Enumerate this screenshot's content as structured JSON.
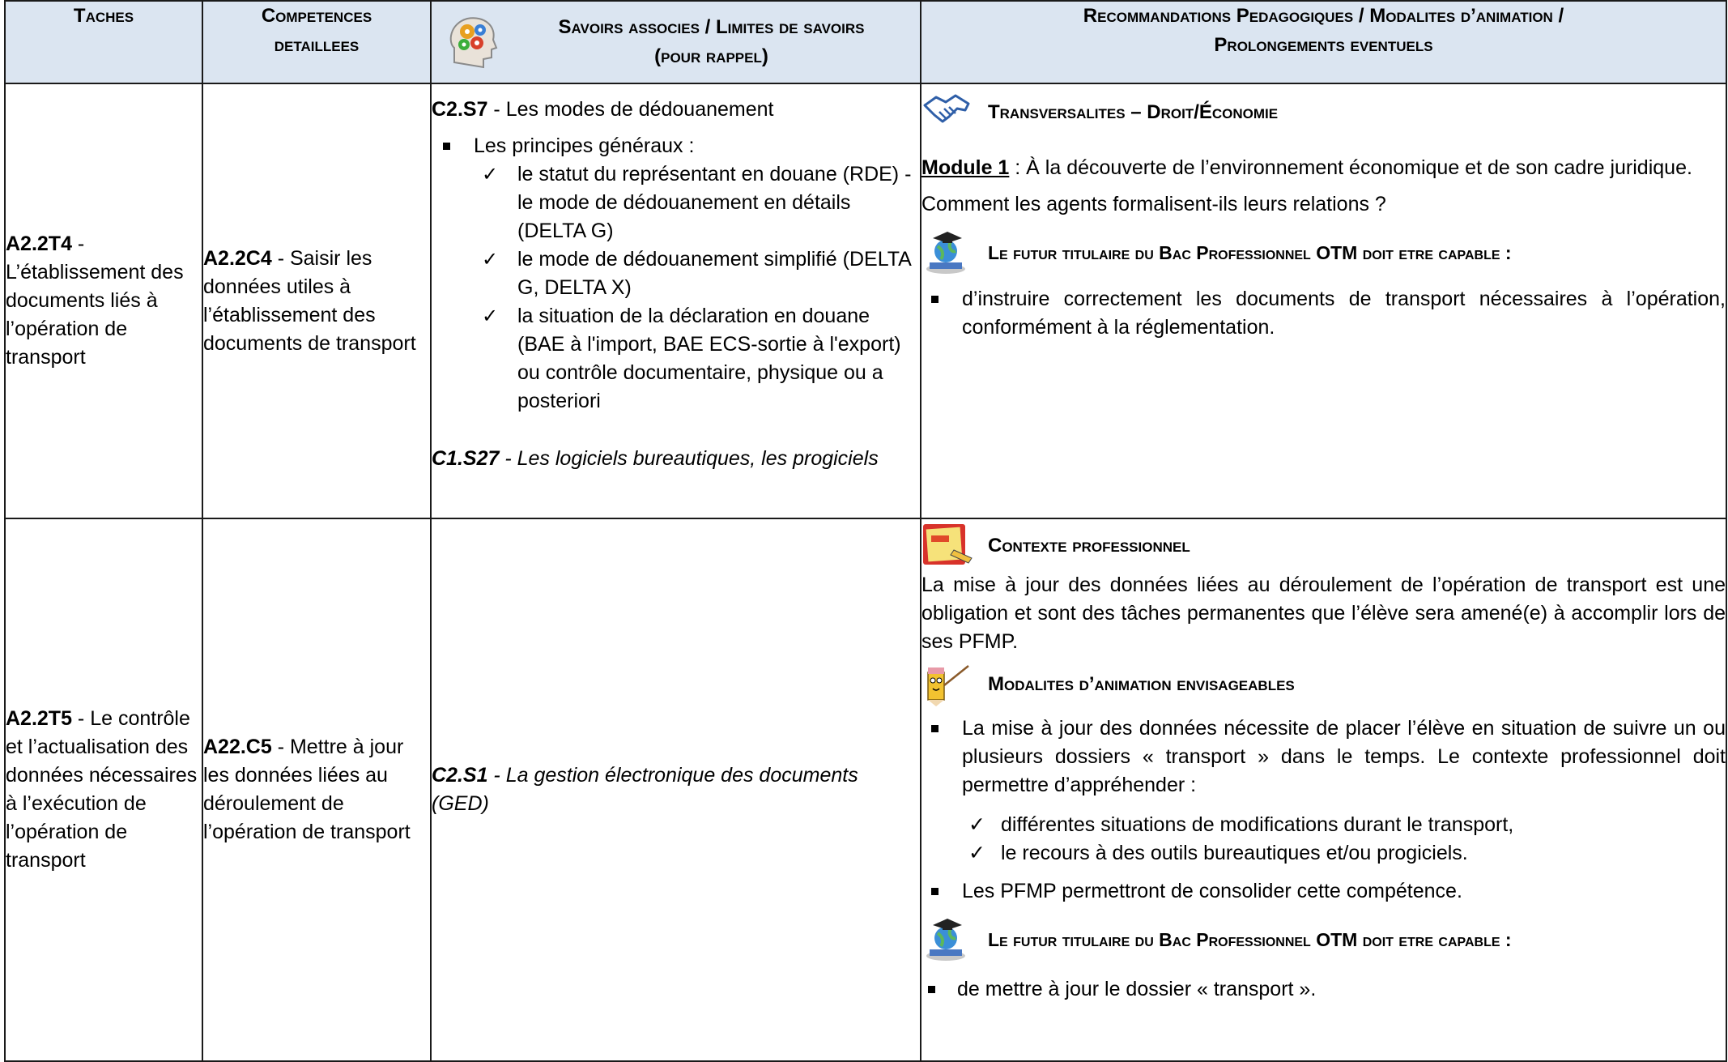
{
  "header": {
    "col1": "Taches",
    "col2_line1": "Competences",
    "col2_line2": "detaillees",
    "col3_line1": "Savoirs associes / Limites de savoirs",
    "col3_line2": "(pour rappel)",
    "col3_icon": "brain-gears-icon",
    "col4_line1": "Recommandations Pedagogiques / Modalites d’animation /",
    "col4_line2": "Prolongements eventuels"
  },
  "rows": [
    {
      "tache_code": "A2.2T4",
      "tache_text": " - L’établissement des documents liés à l’opération de transport",
      "comp_code": "A2.2C4",
      "comp_text": " - Saisir les données utiles à l’établissement des documents de transport",
      "savoirs": {
        "title_code": "C2.S7",
        "title_text": " - Les modes de dédouanement",
        "bullet": "Les principes généraux :",
        "checks": [
          "le statut du représentant en douane (RDE) - le mode de dédouanement en détails (DELTA G)",
          "le mode de dédouanement simplifié (DELTA G, DELTA X)",
          "la situation de la déclaration en douane (BAE à l'import, BAE ECS-sortie à l'export) ou contrôle documentaire, physique ou a posteriori"
        ],
        "extra_code": "C1.S27",
        "extra_text": " - Les logiciels bureautiques, les progiciels"
      },
      "reco": {
        "section1_icon": "handshake-icon",
        "section1_title": "Transversalites – Droit/Économie",
        "module_label": "Module 1",
        "module_text": " : À la découverte de l’environnement économique et de son cadre juridique.",
        "question": "Comment les agents formalisent-ils leurs relations ?",
        "section2_icon": "graduate-globe-icon",
        "section2_title": "Le futur titulaire du Bac Professionnel OTM doit etre capable :",
        "bullet": "d’instruire correctement les documents de transport nécessaires à l’opération, conformément à la réglementation."
      }
    },
    {
      "tache_code": "A2.2T5",
      "tache_text": " - Le contrôle et l’actualisation des données nécessaires à l’exécution de l’opération de transport",
      "comp_code": "A22.C5",
      "comp_text": " - Mettre à jour les données liées au déroulement de l’opération de transport",
      "savoirs": {
        "code": "C2.S1",
        "text": " - La gestion électronique des documents (GED)"
      },
      "reco": {
        "section1_icon": "note-pad-icon",
        "section1_title": "Contexte professionnel",
        "context_text": "La mise à jour des données liées au déroulement de l’opération de transport est une obligation et sont des tâches permanentes que l’élève sera amené(e) à accomplir lors de ses PFMP.",
        "section2_icon": "pencil-teacher-icon",
        "section2_title": "Modalites d’animation envisageables",
        "bullet1": "La mise à jour des données nécessite de placer l’élève en situation de suivre un ou plusieurs dossiers « transport » dans le temps. Le contexte professionnel doit permettre d’appréhender :",
        "checks": [
          "différentes situations de modifications durant le transport,",
          "le recours à des outils bureautiques et/ou progiciels."
        ],
        "bullet2": "Les PFMP permettront de consolider cette compétence.",
        "section3_icon": "graduate-globe-icon",
        "section3_title": "Le futur titulaire du Bac Professionnel OTM doit etre capable :",
        "bullet3": "de mettre à jour le dossier « transport »."
      }
    }
  ],
  "colors": {
    "header_bg": "#dbe5f1",
    "border": "#1a1a1a"
  }
}
